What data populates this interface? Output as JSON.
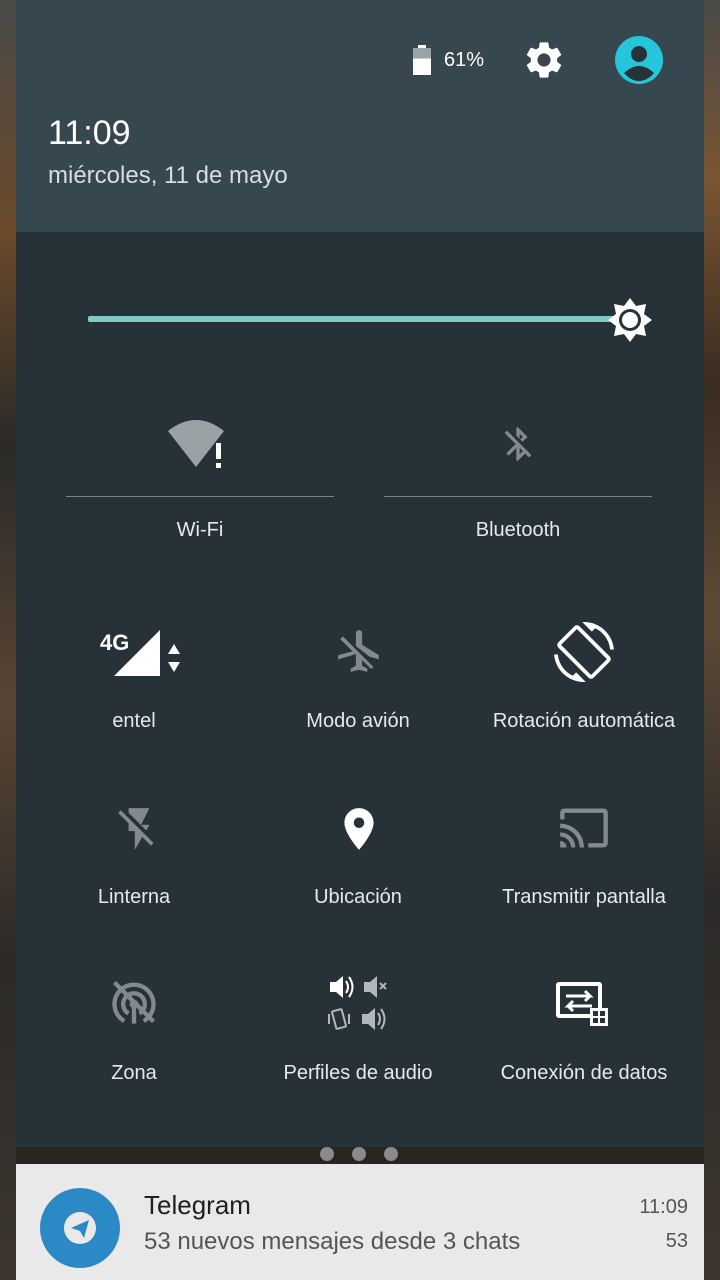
{
  "status": {
    "battery_percent": "61%",
    "battery_level": 0.61
  },
  "header": {
    "time": "11:09",
    "date": "miércoles, 11 de mayo"
  },
  "brightness": {
    "level": 0.95
  },
  "tiles": [
    {
      "label": "Wi-Fi",
      "icon": "wifi-no-internet-icon"
    },
    {
      "label": "Bluetooth",
      "icon": "bluetooth-disabled-icon"
    },
    {
      "label": "entel",
      "icon": "cellular-4g-icon",
      "network": "4G"
    },
    {
      "label": "Modo avión",
      "icon": "airplane-off-icon"
    },
    {
      "label": "Rotación automática",
      "icon": "auto-rotate-icon"
    },
    {
      "label": "Linterna",
      "icon": "flashlight-off-icon"
    },
    {
      "label": "Ubicación",
      "icon": "location-pin-icon"
    },
    {
      "label": "Transmitir pantalla",
      "icon": "cast-icon"
    },
    {
      "label": "Zona",
      "icon": "hotspot-off-icon"
    },
    {
      "label": "Perfiles de audio",
      "icon": "audio-profiles-icon"
    },
    {
      "label": "Conexión de datos",
      "icon": "data-connection-icon"
    }
  ],
  "page_indicator": {
    "pages": 3
  },
  "notification": {
    "app": "Telegram",
    "text": "53 nuevos mensajes desde 3 chats",
    "time": "11:09",
    "count": "53"
  },
  "colors": {
    "panel_bg": "#263238",
    "header_bg": "#37474f",
    "accent_teal": "#80cbc4",
    "avatar_cyan": "#26c6da",
    "telegram_blue": "#2b8ac6"
  }
}
